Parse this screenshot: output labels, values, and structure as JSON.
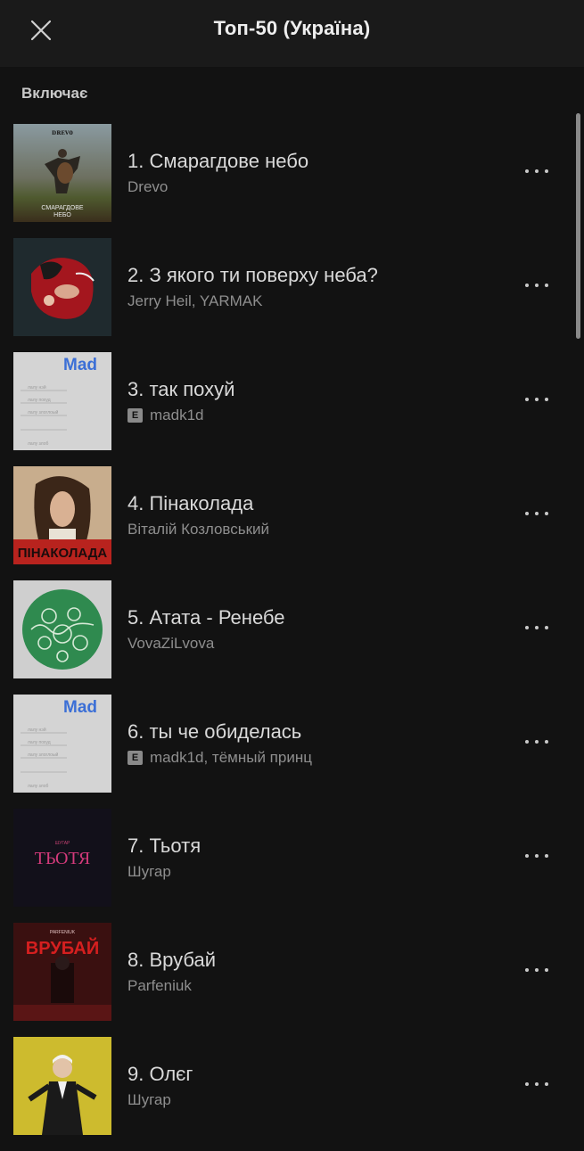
{
  "header": {
    "title": "Топ-50 (Україна)",
    "close_icon": "close-icon"
  },
  "section": {
    "label": "Включає"
  },
  "tracks": [
    {
      "title": "1. Смарагдове небо",
      "artist": "Drevo",
      "explicit": false,
      "cover_text": "СМАРАГДОВЕ НЕБО"
    },
    {
      "title": "2. З якого ти поверху неба?",
      "artist": "Jerry Heil, YARMAK",
      "explicit": false
    },
    {
      "title": "3. так похуй",
      "artist": "madk1d",
      "explicit": true,
      "cover_text": "Mad"
    },
    {
      "title": "4. Пінаколада",
      "artist": "Віталій Козловський",
      "explicit": false,
      "cover_text": "ПІНАКОЛАДА"
    },
    {
      "title": "5. Атата - Ренебе",
      "artist": "VovaZiLvova",
      "explicit": false
    },
    {
      "title": "6. ты че обиделась",
      "artist": "madk1d, тёмный принц",
      "explicit": true,
      "cover_text": "Mad"
    },
    {
      "title": "7. Тьотя",
      "artist": "Шугар",
      "explicit": false,
      "cover_text": "ТЬОТЯ"
    },
    {
      "title": "8. Врубай",
      "artist": "Parfeniuk",
      "explicit": false,
      "cover_text": "ВРУБАЙ"
    },
    {
      "title": "9. Олєг",
      "artist": "Шугар",
      "explicit": false
    }
  ],
  "explicit_badge": "E",
  "colors": {
    "background": "#121212",
    "header": "#1a1a1a",
    "title_text": "#d9d9d9",
    "artist_text": "#8e8e8e"
  }
}
